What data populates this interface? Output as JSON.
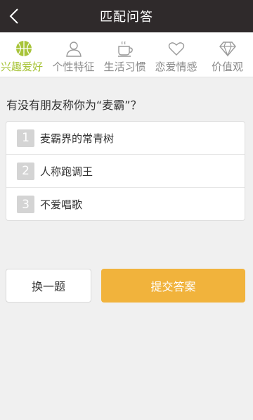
{
  "header": {
    "title": "匹配问答",
    "back_icon": "chevron-left-icon"
  },
  "tabs": [
    {
      "label": "兴趣爱好",
      "icon": "basketball-icon",
      "active": true
    },
    {
      "label": "个性特征",
      "icon": "person-icon",
      "active": false
    },
    {
      "label": "生活习惯",
      "icon": "coffee-cup-icon",
      "active": false
    },
    {
      "label": "恋爱情感",
      "icon": "heart-icon",
      "active": false
    },
    {
      "label": "价值观",
      "icon": "diamond-icon",
      "active": false
    }
  ],
  "question": {
    "text": "有没有朋友称你为“麦霸”？"
  },
  "options": [
    {
      "number": "1",
      "text": "麦霸界的常青树"
    },
    {
      "number": "2",
      "text": "人称跑调王"
    },
    {
      "number": "3",
      "text": "不爱唱歌"
    }
  ],
  "actions": {
    "skip_label": "换一题",
    "submit_label": "提交答案"
  },
  "colors": {
    "header_bg": "#2f2a2b",
    "active_tab": "#a8c43a",
    "submit_bg": "#f1b33c"
  }
}
